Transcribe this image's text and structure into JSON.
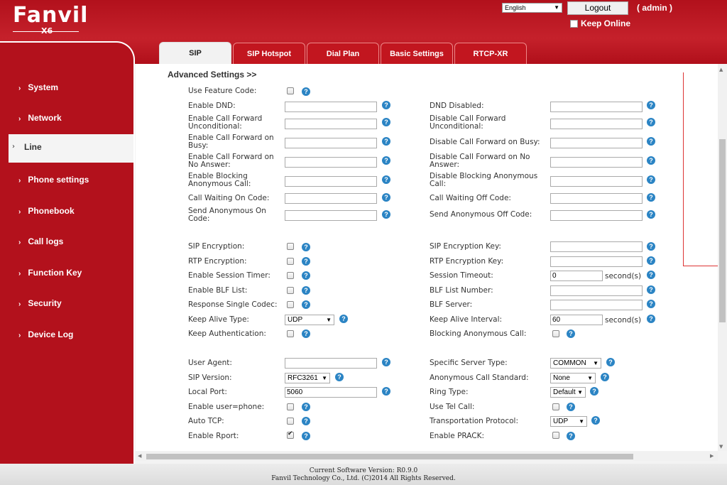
{
  "header": {
    "brand": "Fanvil",
    "model": "X6",
    "language": "English",
    "logout_label": "Logout",
    "user": "( admin )",
    "keep_online_label": "Keep Online"
  },
  "sidebar": {
    "items": [
      {
        "label": "System"
      },
      {
        "label": "Network"
      },
      {
        "label": "Line"
      },
      {
        "label": "Phone settings"
      },
      {
        "label": "Phonebook"
      },
      {
        "label": "Call logs"
      },
      {
        "label": "Function Key"
      },
      {
        "label": "Security"
      },
      {
        "label": "Device Log"
      }
    ],
    "active": "Line"
  },
  "tabs": [
    {
      "label": "SIP"
    },
    {
      "label": "SIP Hotspot"
    },
    {
      "label": "Dial Plan"
    },
    {
      "label": "Basic Settings"
    },
    {
      "label": "RTCP-XR"
    }
  ],
  "section_title": "Advanced Settings >>",
  "form": {
    "use_feature_code": {
      "label": "Use Feature Code:",
      "checked": false
    },
    "enable_dnd": {
      "label": "Enable DND:",
      "value": ""
    },
    "dnd_disabled": {
      "label": "DND Disabled:",
      "value": ""
    },
    "ecf_uncond": {
      "label": "Enable Call Forward Unconditional:",
      "value": ""
    },
    "dcf_uncond": {
      "label": "Disable Call Forward Unconditional:",
      "value": ""
    },
    "ecf_busy": {
      "label": "Enable Call Forward on Busy:",
      "value": ""
    },
    "dcf_busy": {
      "label": "Disable Call Forward on Busy:",
      "value": ""
    },
    "ecf_noans": {
      "label": "Enable Call Forward on No Answer:",
      "value": ""
    },
    "dcf_noans": {
      "label": "Disable Call Forward on No Answer:",
      "value": ""
    },
    "eblock_anon": {
      "label": "Enable Blocking Anonymous Call:",
      "value": ""
    },
    "dblock_anon": {
      "label": "Disable Blocking Anonymous Call:",
      "value": ""
    },
    "cw_on": {
      "label": "Call Waiting On Code:",
      "value": ""
    },
    "cw_off": {
      "label": "Call Waiting Off Code:",
      "value": ""
    },
    "send_anon_on": {
      "label": "Send Anonymous On Code:",
      "value": ""
    },
    "send_anon_off": {
      "label": "Send Anonymous Off Code:",
      "value": ""
    },
    "sip_enc": {
      "label": "SIP Encryption:",
      "checked": false
    },
    "sip_enc_key": {
      "label": "SIP Encryption Key:",
      "value": ""
    },
    "rtp_enc": {
      "label": "RTP Encryption:",
      "checked": false
    },
    "rtp_enc_key": {
      "label": "RTP Encryption Key:",
      "value": ""
    },
    "session_timer": {
      "label": "Enable Session Timer:",
      "checked": false
    },
    "session_timeout": {
      "label": "Session Timeout:",
      "value": "0",
      "unit": "second(s)"
    },
    "blf_list": {
      "label": "Enable BLF List:",
      "checked": false
    },
    "blf_list_number": {
      "label": "BLF List Number:",
      "value": ""
    },
    "resp_single_codec": {
      "label": "Response Single Codec:",
      "checked": false
    },
    "blf_server": {
      "label": "BLF Server:",
      "value": ""
    },
    "keep_alive_type": {
      "label": "Keep Alive Type:",
      "value": "UDP"
    },
    "keep_alive_interval": {
      "label": "Keep Alive Interval:",
      "value": "60",
      "unit": "second(s)"
    },
    "keep_auth": {
      "label": "Keep Authentication:",
      "checked": false
    },
    "block_anon_call": {
      "label": "Blocking Anonymous Call:",
      "checked": false
    },
    "user_agent": {
      "label": "User Agent:",
      "value": ""
    },
    "specific_server": {
      "label": "Specific Server Type:",
      "value": "COMMON"
    },
    "sip_version": {
      "label": "SIP Version:",
      "value": "RFC3261"
    },
    "anon_call_std": {
      "label": "Anonymous Call Standard:",
      "value": "None"
    },
    "local_port": {
      "label": "Local Port:",
      "value": "5060"
    },
    "ring_type": {
      "label": "Ring Type:",
      "value": "Default"
    },
    "user_phone": {
      "label": "Enable user=phone:",
      "checked": false
    },
    "use_tel_call": {
      "label": "Use Tel Call:",
      "checked": false
    },
    "auto_tcp": {
      "label": "Auto TCP:",
      "checked": false
    },
    "transport": {
      "label": "Transportation Protocol:",
      "value": "UDP"
    },
    "rport": {
      "label": "Enable Rport:",
      "checked": true
    },
    "prack": {
      "label": "Enable PRACK:",
      "checked": false
    }
  },
  "footer": {
    "version": "Current Software Version: R0.9.0",
    "copyright": "Fanvil Technology Co., Ltd. (C)2014 All Rights Reserved."
  },
  "colors": {
    "brand_red": "#b3111c",
    "help_blue": "#2b84c4"
  }
}
